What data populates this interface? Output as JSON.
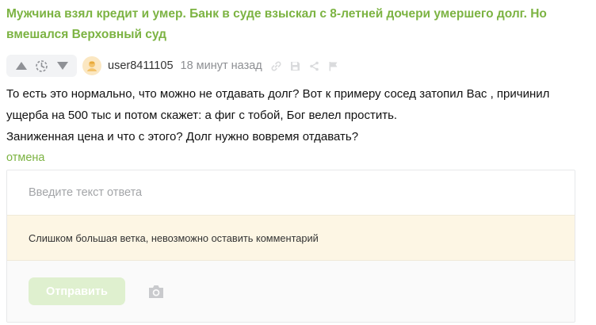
{
  "post": {
    "title": "Мужчина взял кредит и умер. Банк в суде взыскал с 8-летней дочери умершего долг. Но вмешался Верховный суд"
  },
  "comment": {
    "username": "user8411105",
    "time": "18 минут назад",
    "lines": [
      "То есть это нормально, что можно не отдавать долг? Вот к примеру сосед затопил Вас , причинил ущерба на 500 тыс и потом скажет: а фиг с тобой, Бог велел простить.",
      "Заниженная цена и что с этого? Долг нужно вовремя отдавать?"
    ]
  },
  "toolbar": {
    "icons": [
      "arrow-up-icon",
      "clock-rating-icon",
      "arrow-down-icon",
      "link-icon",
      "save-icon",
      "share-icon",
      "report-flag-icon"
    ]
  },
  "reply": {
    "cancel_label": "отмена",
    "placeholder": "Введите текст ответа",
    "warning": "Слишком большая ветка, невозможно оставить комментарий",
    "send_label": "Отправить"
  },
  "colors": {
    "accent": "#7cb342",
    "send_button_disabled": "#dff0cf",
    "warning_bg": "#fdf6e4",
    "votes_bg": "#f2f3f5",
    "muted_text": "#8d8f93"
  }
}
